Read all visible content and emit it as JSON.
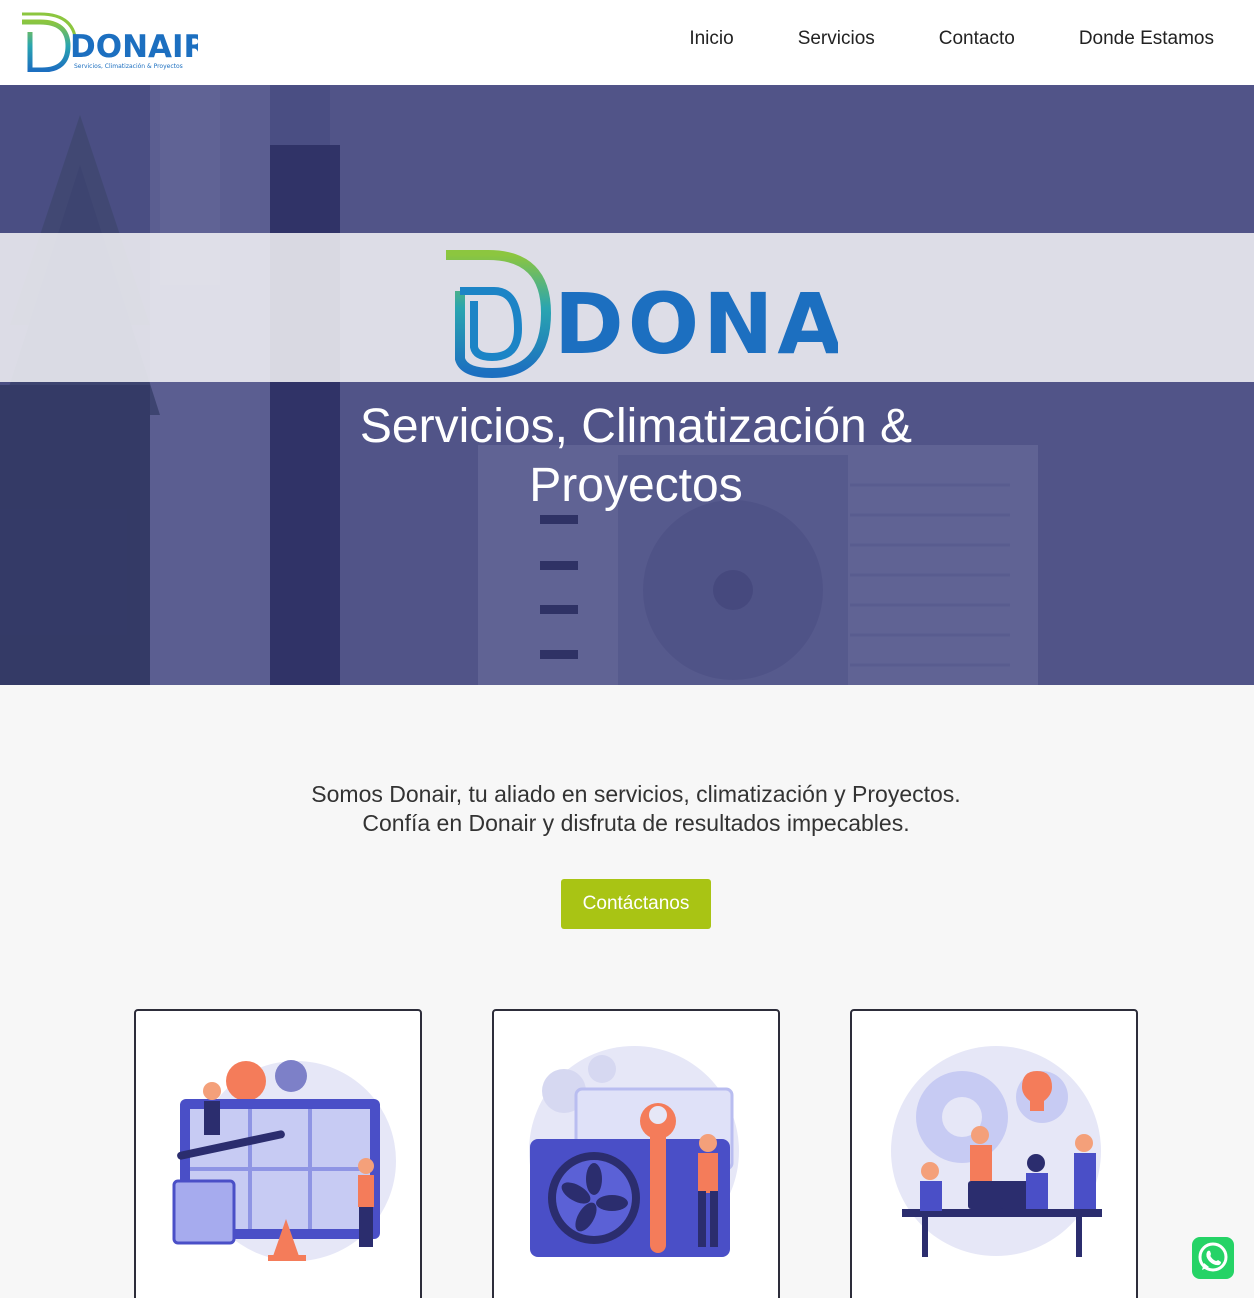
{
  "header": {
    "brand_name": "DONAIR",
    "brand_tagline": "Servicios, Climatización & Proyectos",
    "nav": [
      "Inicio",
      "Servicios",
      "Contacto",
      "Donde Estamos"
    ]
  },
  "hero": {
    "logo_text": "DONAIR",
    "title": "Servicios, Climatización & Proyectos"
  },
  "intro": {
    "line1": "Somos Donair, tu aliado en servicios, climatización y Proyectos.",
    "line2": "Confía en Donair y disfruta de resultados impecables.",
    "cta_label": "Contáctanos"
  },
  "cards": [
    {
      "illustration": "maintenance-workers-illustration"
    },
    {
      "illustration": "ac-unit-repair-illustration"
    },
    {
      "illustration": "team-project-illustration"
    }
  ],
  "colors": {
    "brand_blue": "#1c6fc0",
    "brand_green": "#a9c414",
    "hero_overlay": "#303476",
    "whatsapp": "#25d366"
  },
  "icons": {
    "whatsapp": "whatsapp-icon"
  }
}
